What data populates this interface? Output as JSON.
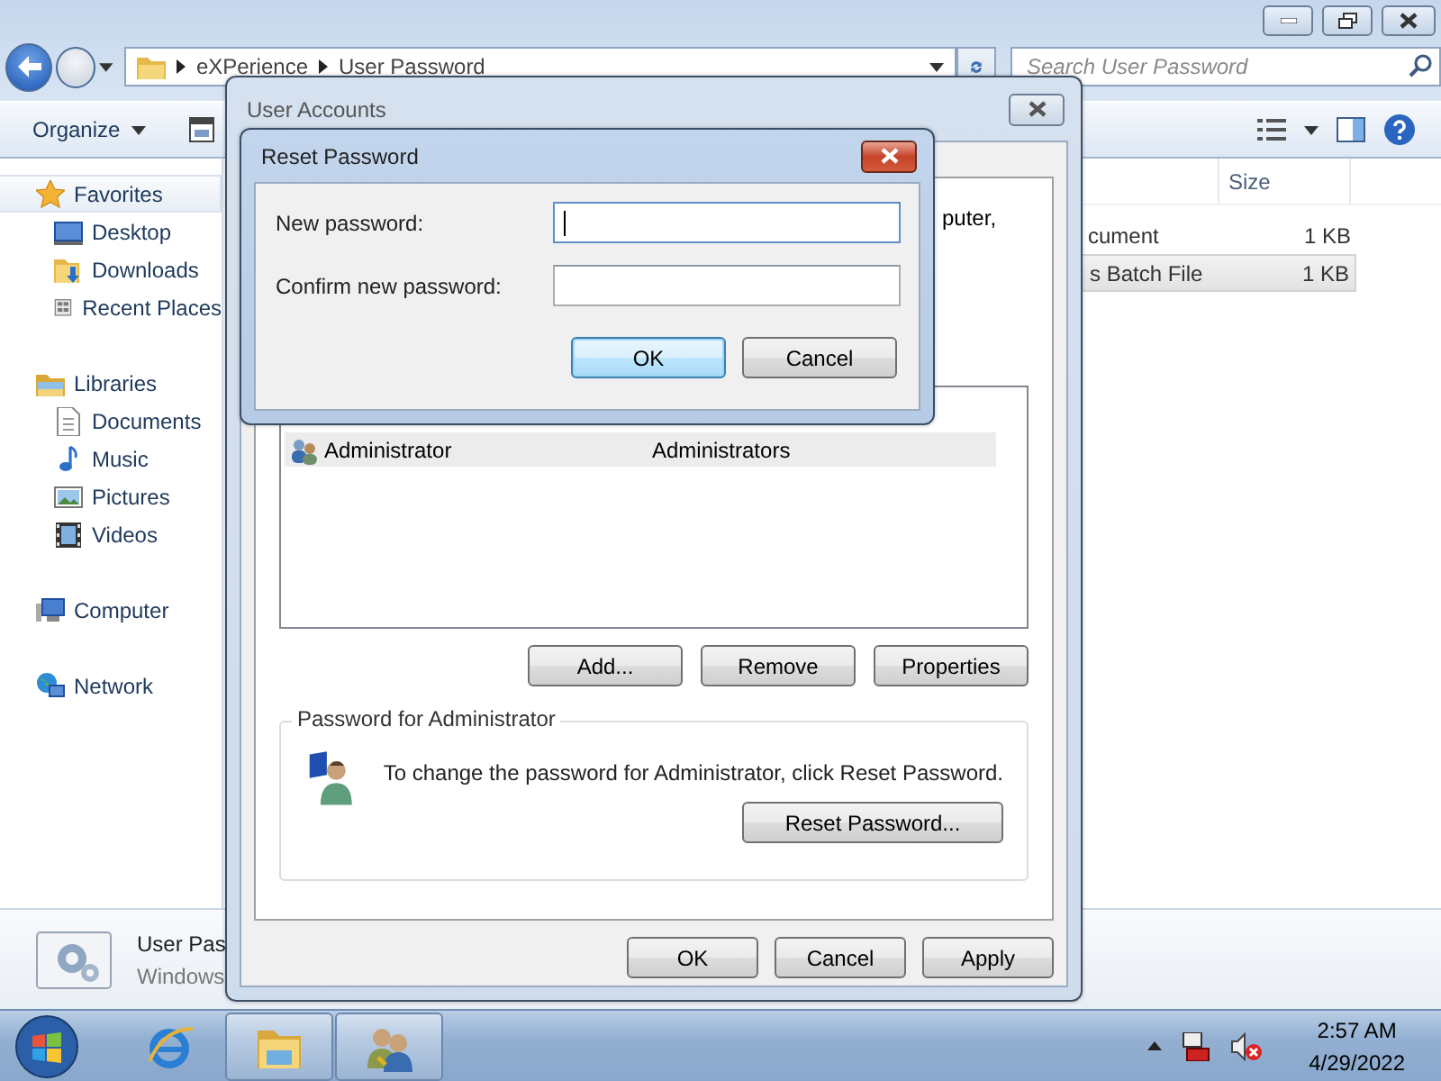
{
  "explorer": {
    "breadcrumb": [
      "eXPerience",
      "User Password"
    ],
    "search": {
      "placeholder": "Search User Password"
    },
    "toolbar": {
      "organize": "Organize"
    },
    "nav": [
      {
        "label": "Favorites",
        "selected": true,
        "children": [
          {
            "label": "Desktop",
            "selected": false
          },
          {
            "label": "Downloads",
            "selected": false
          },
          {
            "label": "Recent Places",
            "selected": false
          }
        ]
      },
      {
        "label": "Libraries",
        "selected": false,
        "children": [
          {
            "label": "Documents",
            "selected": false
          },
          {
            "label": "Music",
            "selected": false
          },
          {
            "label": "Pictures",
            "selected": false
          },
          {
            "label": "Videos",
            "selected": false
          }
        ]
      },
      {
        "label": "Computer",
        "selected": false
      },
      {
        "label": "Network",
        "selected": false
      }
    ],
    "columns": [
      "Size"
    ],
    "files": [
      {
        "name": "cument",
        "size": "1 KB",
        "selected": false
      },
      {
        "name": "s Batch File",
        "size": "1 KB",
        "selected": true
      }
    ],
    "details": {
      "title": "User Pas",
      "subtitle": "Windows"
    }
  },
  "user_accounts": {
    "title": "User Accounts",
    "active": false,
    "partial_text": "puter,",
    "users": [
      {
        "name": "Administrator",
        "group": "Administrators",
        "selected": true
      }
    ],
    "buttons": [
      "Add...",
      "Remove",
      "Properties"
    ],
    "password_group": {
      "title": "Password for Administrator",
      "text": "To change the password for Administrator, click Reset Password.",
      "button": "Reset Password..."
    },
    "footer_buttons": [
      "OK",
      "Cancel",
      "Apply"
    ]
  },
  "reset_password": {
    "title": "Reset Password",
    "active": true,
    "fields": [
      {
        "label": "New password:",
        "focused": true
      },
      {
        "label": "Confirm new password:",
        "focused": false
      }
    ],
    "buttons": [
      {
        "label": "OK",
        "default": true
      },
      {
        "label": "Cancel",
        "default": false
      }
    ]
  },
  "taskbar": {
    "apps": [
      {
        "running": false
      },
      {
        "running": true
      },
      {
        "running": true
      }
    ],
    "time": "2:57 AM",
    "date": "4/29/2022"
  }
}
